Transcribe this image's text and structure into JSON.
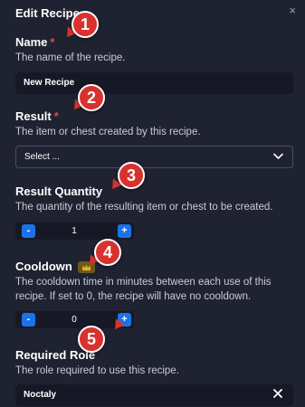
{
  "dialog": {
    "title": "Edit Recipe",
    "close_glyph": "×"
  },
  "fields": {
    "name": {
      "label": "Name",
      "required_mark": "*",
      "description": "The name of the recipe.",
      "value": "New Recipe"
    },
    "result": {
      "label": "Result",
      "required_mark": "*",
      "description": "The item or chest created by this recipe.",
      "selected": "Select ...",
      "icon": "chevron-down-icon"
    },
    "result_quantity": {
      "label": "Result Quantity",
      "description": "The quantity of the resulting item or chest to be created.",
      "value": "1",
      "minus": "-",
      "plus": "+"
    },
    "cooldown": {
      "label": "Cooldown",
      "badge_icon": "crown-icon",
      "description": "The cooldown time in minutes between each use of this recipe. If set to 0, the recipe will have no cooldown.",
      "value": "0",
      "minus": "-",
      "plus": "+"
    },
    "required_role": {
      "label": "Required Role",
      "description": "The role required to use this recipe.",
      "value": "Noctaly",
      "clear_icon": "close-icon"
    }
  },
  "annotations": [
    "1",
    "2",
    "3",
    "4",
    "5"
  ],
  "colors": {
    "background": "#1f2231",
    "input_bg": "#161925",
    "accent_blue": "#1a73e8",
    "required_red": "#e5484d",
    "annotation_red": "#d8322e",
    "badge_gold": "#e8b21a"
  }
}
